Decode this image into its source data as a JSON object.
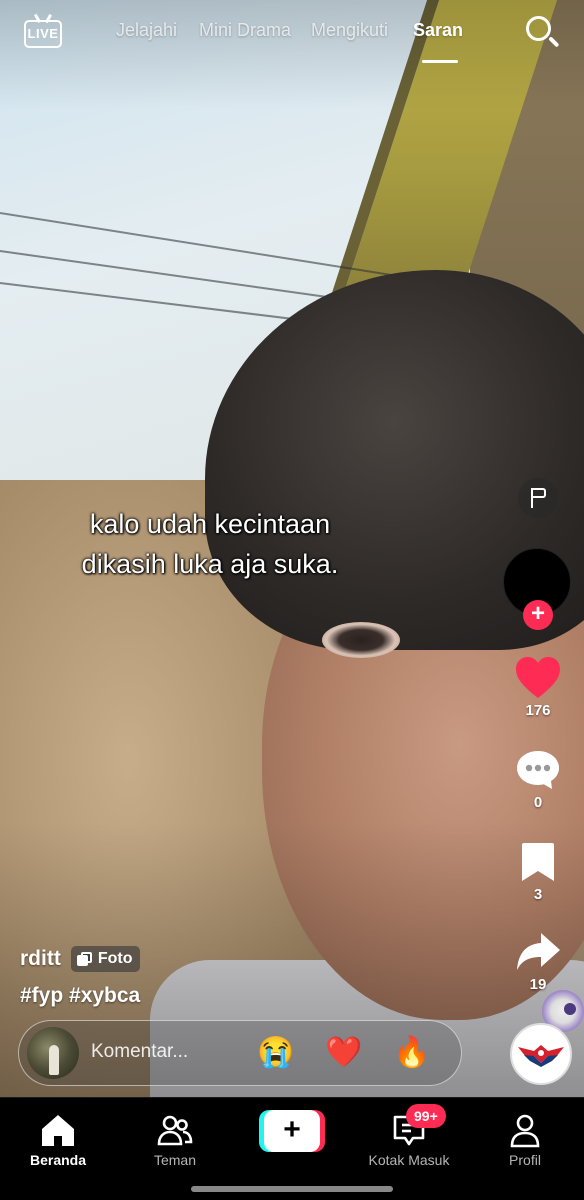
{
  "top_nav": {
    "live_label": "LIVE",
    "tabs": [
      {
        "label": "Jelajahi",
        "active": false
      },
      {
        "label": "Mini Drama",
        "active": false
      },
      {
        "label": "Mengikuti",
        "active": false
      },
      {
        "label": "Saran",
        "active": true
      }
    ],
    "search_icon": "search-icon"
  },
  "post": {
    "overlay_text": [
      "kalo udah kecintaan",
      "dikasih luka aja suka."
    ],
    "author": "rditt",
    "type_badge": "Foto",
    "hashtags": "#fyp #xybca"
  },
  "actions": {
    "like_count": "176",
    "comment_count": "0",
    "bookmark_count": "3",
    "share_count": "19"
  },
  "comment_bar": {
    "placeholder": "Komentar...",
    "quick_emojis": [
      "😭",
      "❤️",
      "🔥"
    ]
  },
  "bottom_nav": {
    "items": [
      {
        "label": "Beranda",
        "active": true
      },
      {
        "label": "Teman",
        "active": false
      },
      {
        "label": "Kotak Masuk",
        "active": false
      },
      {
        "label": "Profil",
        "active": false
      }
    ],
    "inbox_badge": "99+"
  },
  "colors": {
    "accent_red": "#fe2c55",
    "accent_cyan": "#25f4ee",
    "background": "#000000"
  }
}
